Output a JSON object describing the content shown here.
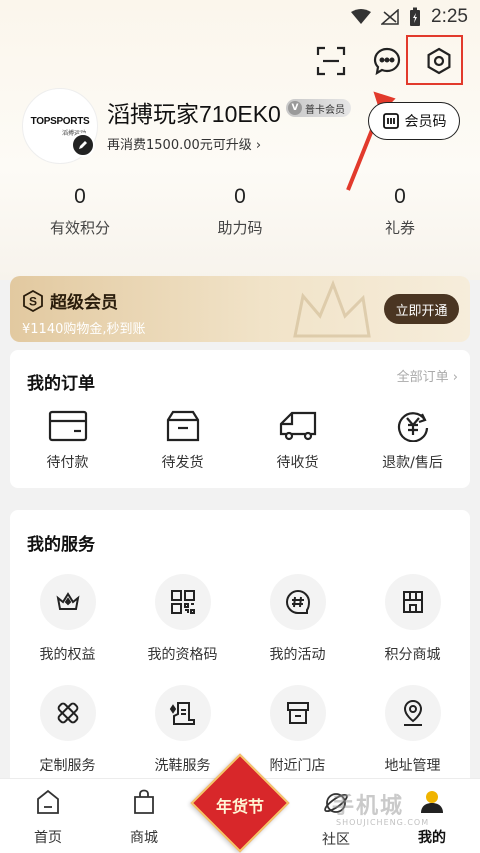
{
  "status_bar": {
    "time": "2:25"
  },
  "header": {
    "scan_icon": "scan-icon",
    "message_icon": "message-icon",
    "settings_icon": "gear-icon"
  },
  "profile": {
    "avatar_logo": "TOPSPORTS",
    "avatar_sub": "滔搏运动",
    "username": "滔搏玩家710EK0",
    "level_badge": "普卡会员",
    "upgrade_hint": "再消费1500.00元可升级",
    "member_code_label": "会员码"
  },
  "stats": [
    {
      "value": "0",
      "label": "有效积分"
    },
    {
      "value": "0",
      "label": "助力码"
    },
    {
      "value": "0",
      "label": "礼券"
    }
  ],
  "vip_banner": {
    "title": "超级会员",
    "subtitle": "¥1140购物金,秒到账",
    "button": "立即开通"
  },
  "orders": {
    "title": "我的订单",
    "all_link": "全部订单 ›",
    "items": [
      {
        "label": "待付款",
        "icon": "wallet-icon"
      },
      {
        "label": "待发货",
        "icon": "box-icon"
      },
      {
        "label": "待收货",
        "icon": "truck-icon"
      },
      {
        "label": "退款/售后",
        "icon": "refund-icon"
      }
    ]
  },
  "services": {
    "title": "我的服务",
    "items": [
      {
        "label": "我的权益",
        "icon": "crown-icon"
      },
      {
        "label": "我的资格码",
        "icon": "qrcode-icon"
      },
      {
        "label": "我的活动",
        "icon": "hashtag-icon"
      },
      {
        "label": "积分商城",
        "icon": "shop-icon"
      },
      {
        "label": "定制服务",
        "icon": "bandage-icon"
      },
      {
        "label": "洗鞋服务",
        "icon": "shoe-wash-icon"
      },
      {
        "label": "附近门店",
        "icon": "store-icon"
      },
      {
        "label": "地址管理",
        "icon": "location-icon"
      }
    ]
  },
  "tabbar": {
    "items": [
      {
        "label": "首页",
        "icon": "home-icon"
      },
      {
        "label": "商城",
        "icon": "bag-icon"
      },
      {
        "label": "社区",
        "icon": "planet-icon"
      },
      {
        "label": "我的",
        "icon": "user-icon"
      }
    ],
    "festival": "年货节"
  },
  "watermark": {
    "text": "手机城",
    "sub": "SHOUJICHENG.COM"
  },
  "colors": {
    "accent_red": "#e23a2c",
    "vip_dark": "#4a3522",
    "festival_red": "#d8272a"
  }
}
